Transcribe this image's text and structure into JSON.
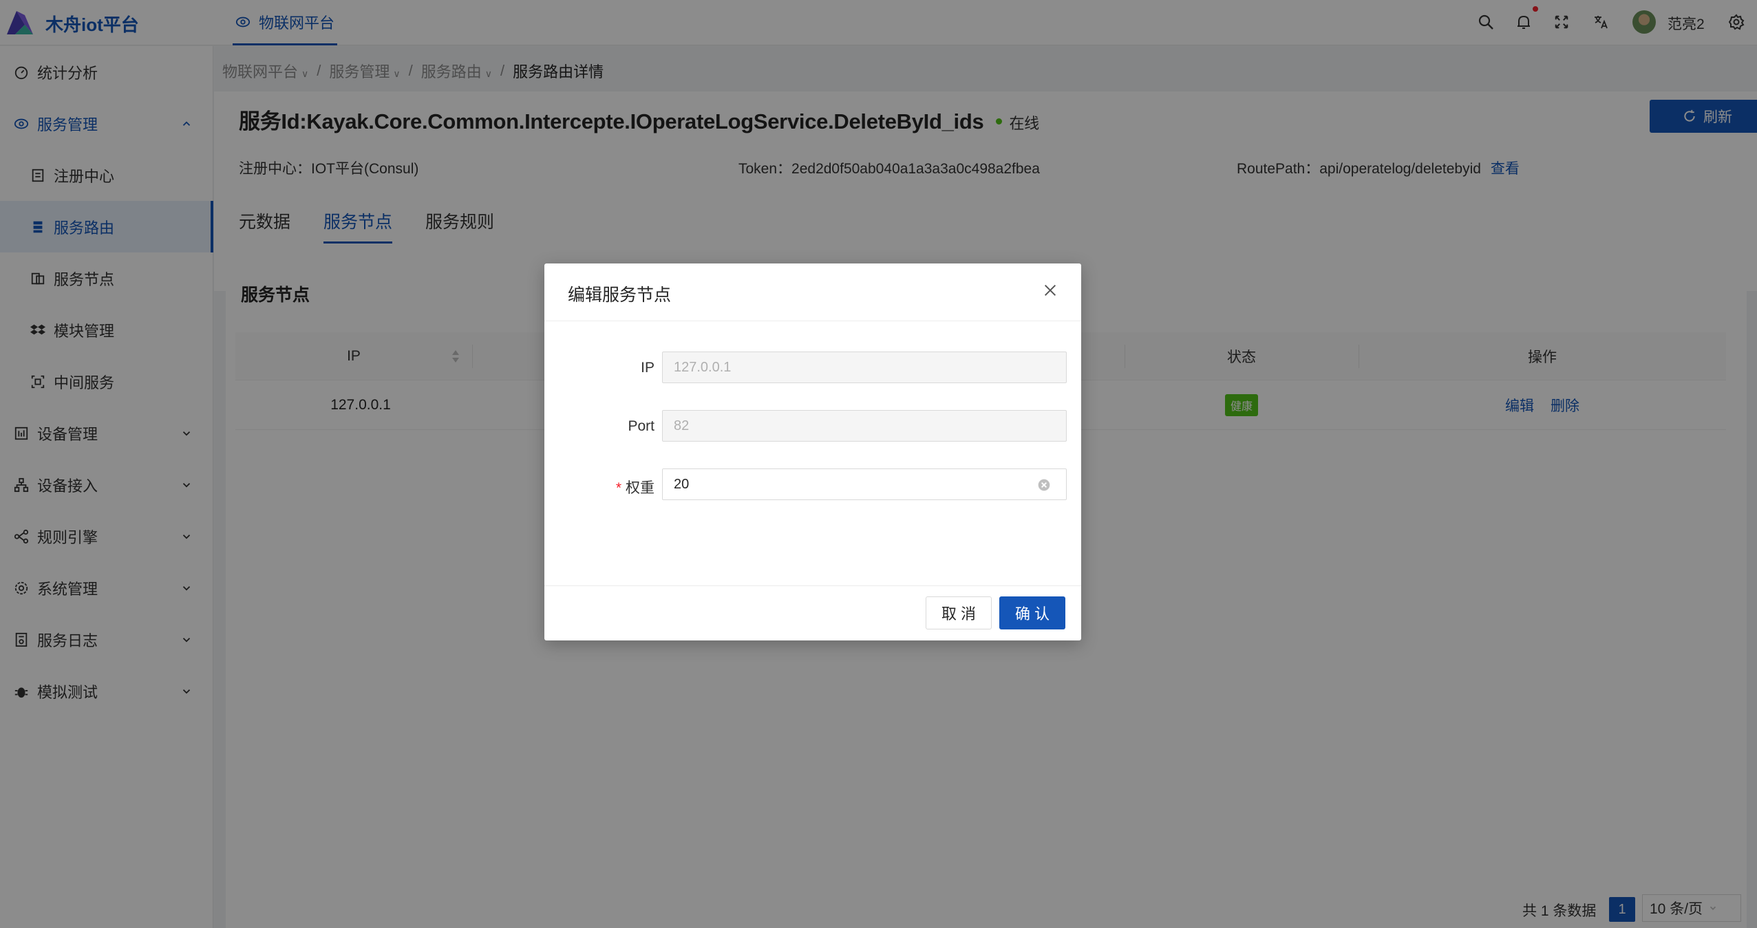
{
  "app": {
    "brand": "木舟iot平台",
    "top_nav": "物联网平台",
    "username": "范亮2"
  },
  "header_icons": [
    "search-icon",
    "bell-icon",
    "fullscreen-icon",
    "translate-icon",
    "gear-icon"
  ],
  "sidebar": {
    "items": [
      {
        "label": "统计分析",
        "icon": "dashboard-icon"
      },
      {
        "label": "服务管理",
        "icon": "cloud-icon"
      },
      {
        "label": "注册中心",
        "icon": "register-icon"
      },
      {
        "label": "服务路由",
        "icon": "route-icon"
      },
      {
        "label": "服务节点",
        "icon": "node-icon"
      },
      {
        "label": "模块管理",
        "icon": "dropbox-icon"
      },
      {
        "label": "中间服务",
        "icon": "middleware-icon"
      },
      {
        "label": "设备管理",
        "icon": "device-icon"
      },
      {
        "label": "设备接入",
        "icon": "hierarchy-icon"
      },
      {
        "label": "规则引擎",
        "icon": "rule-icon"
      },
      {
        "label": "系统管理",
        "icon": "settings-icon"
      },
      {
        "label": "服务日志",
        "icon": "log-icon"
      },
      {
        "label": "模拟测试",
        "icon": "bug-icon"
      }
    ]
  },
  "breadcrumb": [
    "物联网平台",
    "服务管理",
    "服务路由",
    "服务路由详情"
  ],
  "page": {
    "title": "服务Id:Kayak.Core.Common.Intercepte.IOperateLogService.DeleteById_ids",
    "status": "在线",
    "refresh": "刷新",
    "registry": "注册中心：IOT平台(Consul)",
    "token": "Token：2ed2d0f50ab040a1a3a3a0c498a2fbea",
    "route_path": "RoutePath：api/operatelog/deletebyid",
    "view_link": "查看",
    "tabs": [
      "元数据",
      "服务节点",
      "服务规则"
    ]
  },
  "card": {
    "title": "服务节点",
    "columns": {
      "ip": "IP",
      "status": "状态",
      "actions": "操作"
    },
    "rows": [
      {
        "ip": "127.0.0.1",
        "status": "健康",
        "edit": "编辑",
        "delete": "删除"
      }
    ],
    "total": "共 1 条数据",
    "page": "1",
    "page_size": "10 条/页"
  },
  "modal": {
    "title": "编辑服务节点",
    "fields": {
      "ip": {
        "label": "IP",
        "value": "127.0.0.1"
      },
      "port": {
        "label": "Port",
        "value": "82"
      },
      "weight": {
        "label": "权重",
        "value": "20",
        "required_mark": "*"
      }
    },
    "cancel": "取 消",
    "ok": "确 认"
  },
  "colors": {
    "primary": "#1556b8",
    "success": "#52c41a",
    "danger": "#f5222d"
  }
}
